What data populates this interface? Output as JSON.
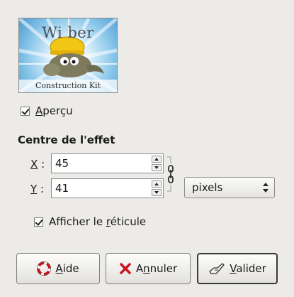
{
  "preview": {
    "title": "Wi ber",
    "caption": "Construction Kit"
  },
  "preview_toggle": {
    "label_first": "A",
    "label_rest": "perçu",
    "checked": true
  },
  "effect_center": {
    "title": "Centre de l'effet",
    "x": {
      "label": "X",
      "colon": ":",
      "value": "45"
    },
    "y": {
      "label": "Y",
      "colon": ":",
      "value": "41"
    },
    "unit": "pixels",
    "chain_linked": true
  },
  "reticle_toggle": {
    "label_before": "Afficher le ",
    "label_mnemonic": "r",
    "label_after": "éticule",
    "checked": true
  },
  "buttons": {
    "help": {
      "mnemonic": "A",
      "rest": "ide",
      "icon": "lifebuoy-icon"
    },
    "cancel": {
      "before": "A",
      "mnemonic": "n",
      "rest": "nuler",
      "icon": "red-x-icon"
    },
    "ok": {
      "mnemonic": "V",
      "rest": "alider",
      "icon": "ok-hand-icon"
    }
  },
  "colors": {
    "background": "#ecebe8",
    "cancel_x": "#c8141c",
    "help_ring": "#c8141c"
  }
}
